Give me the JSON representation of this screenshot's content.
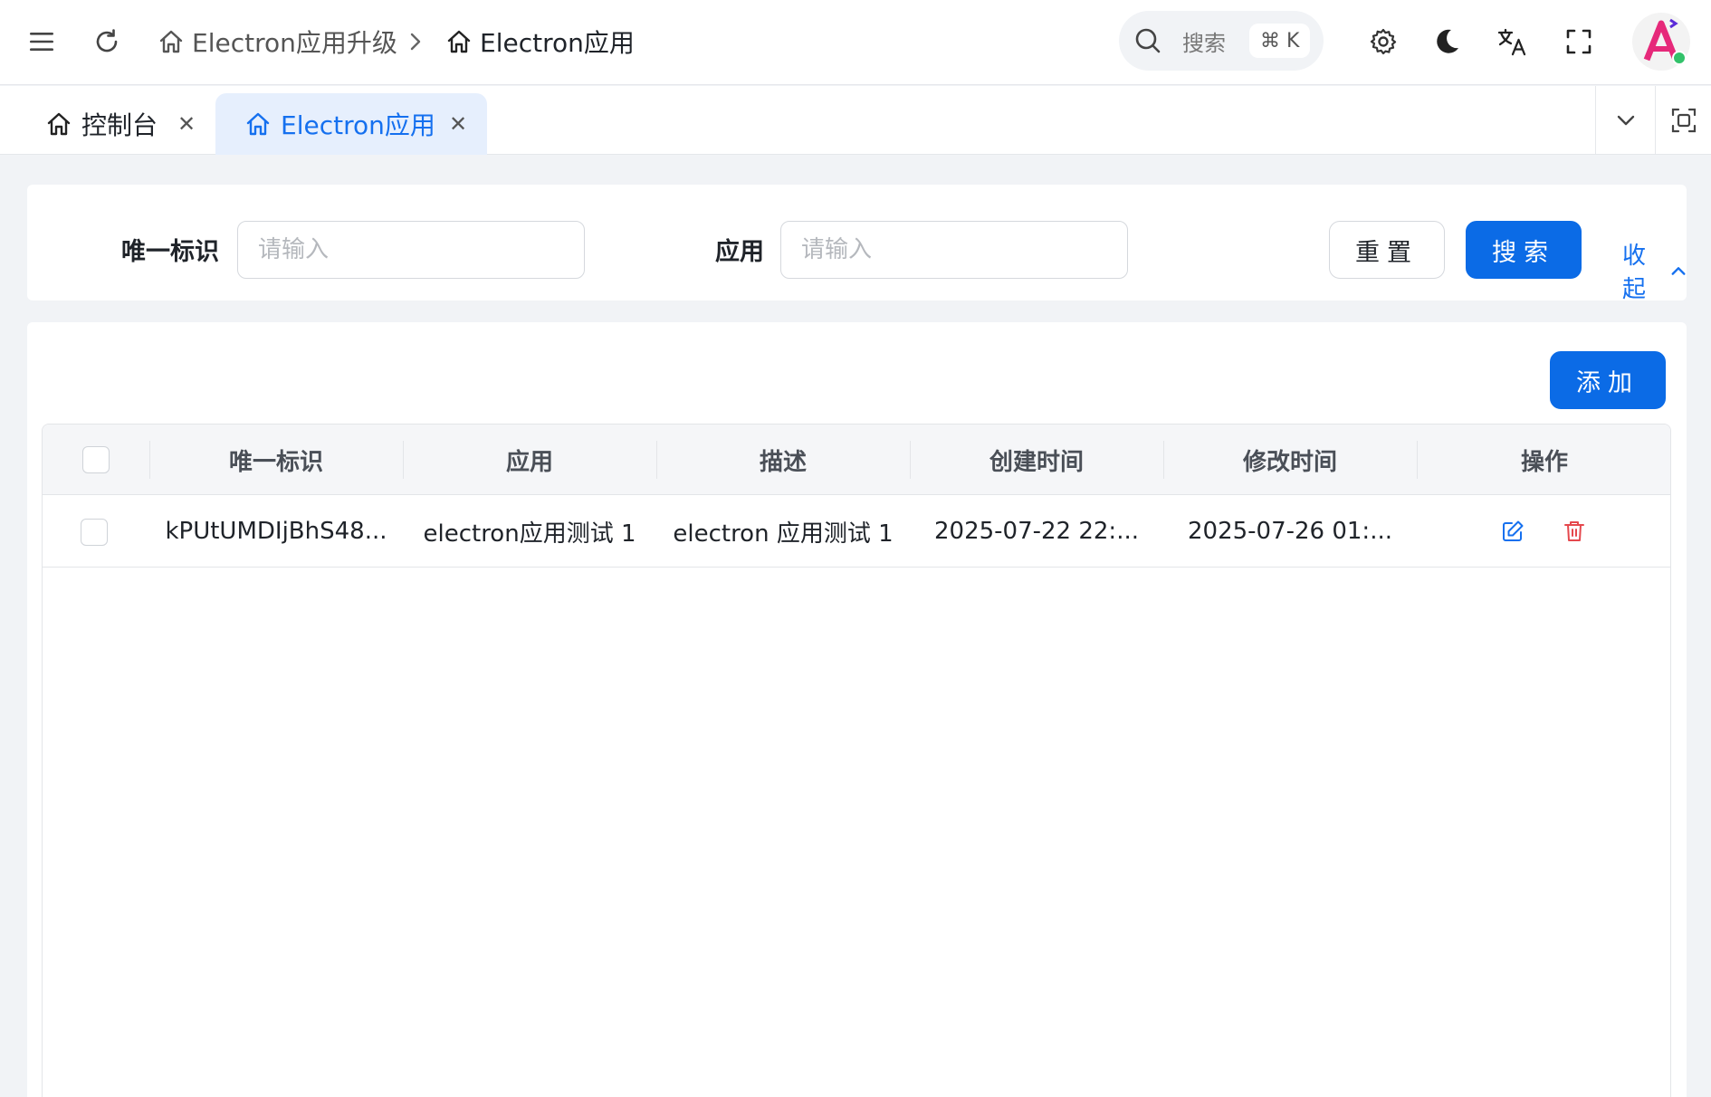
{
  "header": {
    "breadcrumb": [
      "Electron应用升级",
      "Electron应用"
    ],
    "search_placeholder": "搜索",
    "search_shortcut": "⌘ K",
    "icons": [
      "menu-icon",
      "refresh-icon",
      "home-icon",
      "chevron-right-icon",
      "search-icon",
      "gear-icon",
      "moon-icon",
      "translate-icon",
      "fullscreen-icon"
    ]
  },
  "tabs": [
    {
      "label": "控制台",
      "active": false
    },
    {
      "label": "Electron应用",
      "active": true
    }
  ],
  "filter": {
    "fields": [
      {
        "label": "唯一标识",
        "placeholder": "请输入"
      },
      {
        "label": "应用",
        "placeholder": "请输入"
      }
    ],
    "reset_label": "重置",
    "search_label": "搜索",
    "collapse_label": "收起"
  },
  "toolbar": {
    "add_label": "添加"
  },
  "table": {
    "columns": [
      "唯一标识",
      "应用",
      "描述",
      "创建时间",
      "修改时间",
      "操作"
    ],
    "rows": [
      {
        "id": "kPUtUMDIjBhS48...",
        "app": "electron应用测试 1",
        "desc": "electron 应用测试 1",
        "created": "2025-07-22 22:...",
        "modified": "2025-07-26 01:..."
      }
    ]
  },
  "colors": {
    "primary": "#0b6be6",
    "danger": "#e5484d",
    "active_tab_bg": "#e6effd"
  }
}
